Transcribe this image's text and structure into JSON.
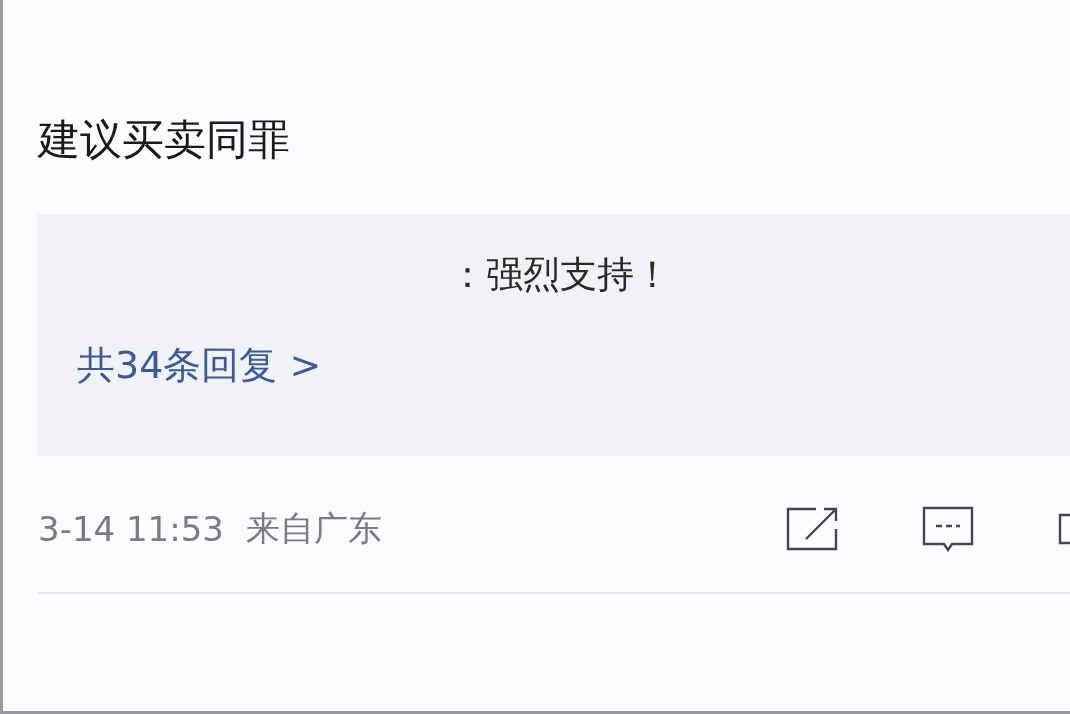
{
  "comment": {
    "text": "建议买卖同罪"
  },
  "reply": {
    "text": "：强烈支持！",
    "more_link": "共34条回复 >"
  },
  "footer": {
    "time": "3-14 11:53",
    "location": "来自广东"
  }
}
